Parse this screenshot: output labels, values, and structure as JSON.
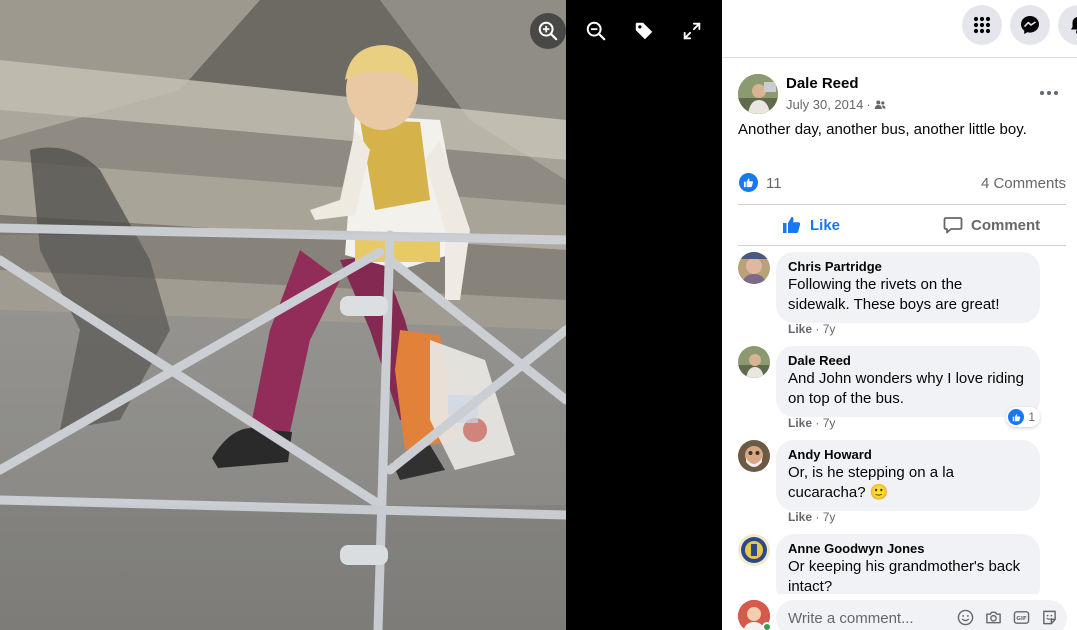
{
  "viewer": {
    "tools": [
      {
        "icon": "zoom-in-icon"
      },
      {
        "icon": "zoom-out-icon"
      },
      {
        "icon": "tag-icon"
      },
      {
        "icon": "fullscreen-icon"
      }
    ]
  },
  "topnav": {
    "icons": [
      "apps-menu-icon",
      "messenger-icon",
      "notifications-icon"
    ]
  },
  "post": {
    "author": "Dale Reed",
    "date": "July 30, 2014",
    "separator": "·",
    "audience_icon": "friends-icon",
    "text": "Another day, another bus, another little boy.",
    "like_count": "11",
    "comment_count": "4 Comments",
    "like_label": "Like",
    "comment_label": "Comment"
  },
  "comments": [
    {
      "name": "Chris Partridge",
      "text": "Following the rivets on the sidewalk. These boys are great!",
      "like": "Like",
      "age": "7y"
    },
    {
      "name": "Dale Reed",
      "text": "And John wonders why I love riding on top of the bus.",
      "like": "Like",
      "age": "7y",
      "reactions": "1"
    },
    {
      "name": "Andy Howard",
      "text": "Or, is he stepping on a la cucaracha? 🙂",
      "like": "Like",
      "age": "7y"
    },
    {
      "name": "Anne Goodwyn Jones",
      "text": "Or keeping his grandmother's back intact?",
      "like": "",
      "age": ""
    }
  ],
  "composer": {
    "placeholder": "Write a comment...",
    "icons": [
      "emoji-icon",
      "camera-icon",
      "gif-icon",
      "sticker-icon"
    ]
  },
  "colors": {
    "accent": "#1877f2",
    "bubble": "#f0f2f5",
    "muted": "#65676b"
  }
}
